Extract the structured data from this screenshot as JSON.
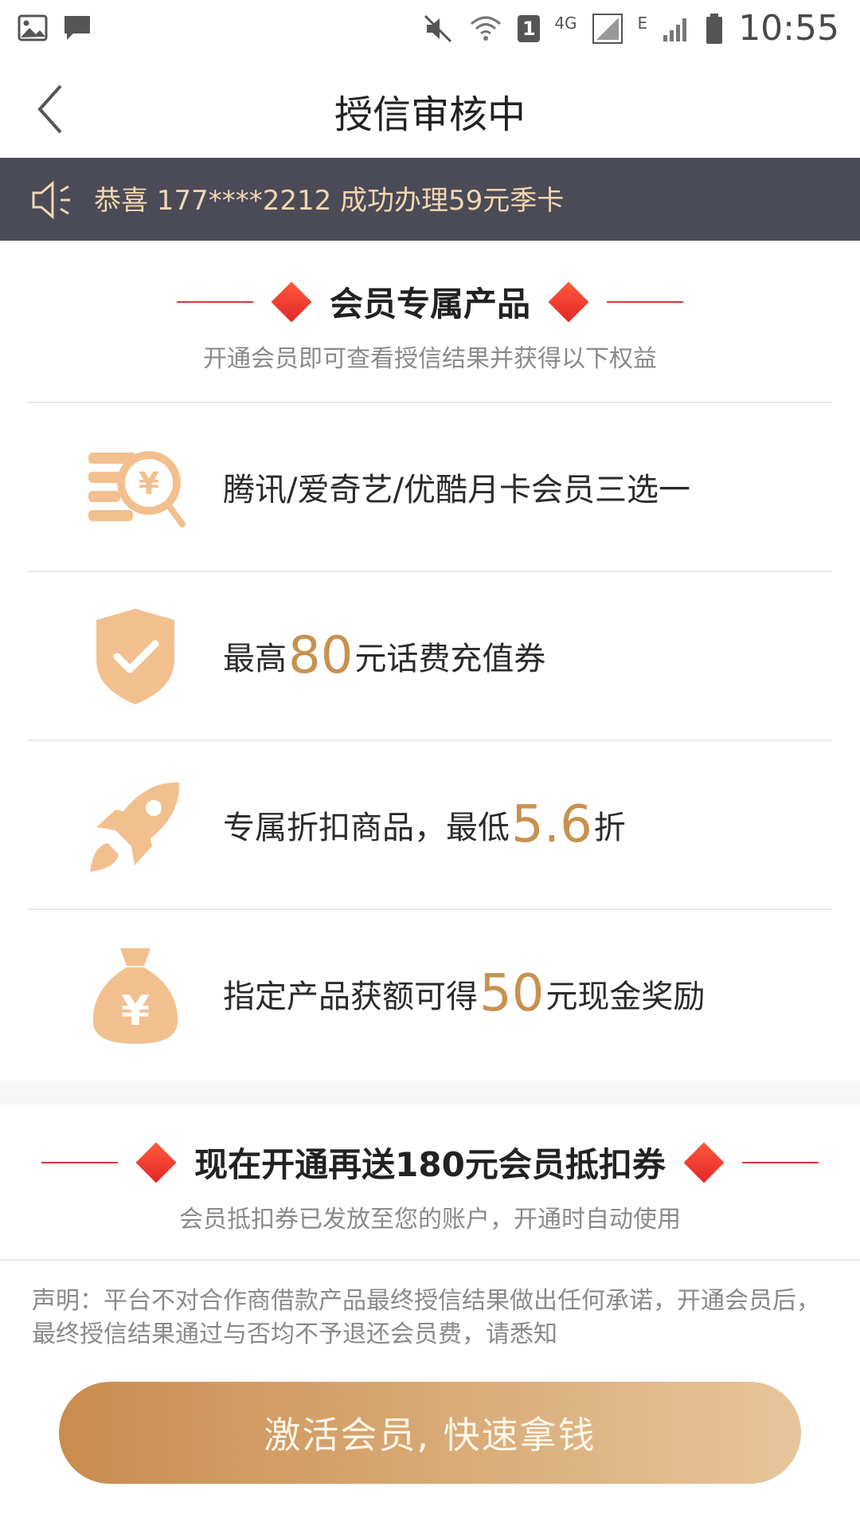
{
  "status_bar": {
    "time": "10:55",
    "icons": [
      "image-icon",
      "chat-icon",
      "mute-icon",
      "wifi-icon",
      "sim1-icon",
      "4g-signal-icon",
      "e-signal-icon",
      "battery-icon"
    ],
    "network_label_1": "4G",
    "network_label_2": "E",
    "sim_label": "1"
  },
  "nav": {
    "title": "授信审核中",
    "back_icon": "chevron-left-icon"
  },
  "notice": {
    "icon": "speaker-icon",
    "text": "恭喜 177****2212 成功办理59元季卡"
  },
  "member_section": {
    "title": "会员专属产品",
    "subtitle": "开通会员即可查看授信结果并获得以下权益",
    "accent_color": "#e3262a"
  },
  "benefits": [
    {
      "icon": "coin-search-icon",
      "text": "腾讯/爱奇艺/优酷月卡会员三选一"
    },
    {
      "icon": "shield-check-icon",
      "prefix": "最高",
      "highlight": "80",
      "suffix": "元话费充值券"
    },
    {
      "icon": "rocket-icon",
      "prefix": "专属折扣商品，最低",
      "highlight": "5.6",
      "suffix": "折"
    },
    {
      "icon": "money-bag-icon",
      "prefix": "指定产品获额可得",
      "highlight": "50",
      "suffix": "元现金奖励"
    }
  ],
  "coupon_section": {
    "title": "现在开通再送180元会员抵扣券",
    "subtitle": "会员抵扣券已发放至您的账户，开通时自动使用"
  },
  "disclaimer": "声明：平台不对合作商借款产品最终授信结果做出任何承诺，开通会员后，最终授信结果通过与否均不予退还会员费，请悉知",
  "cta": {
    "label": "激活会员, 快速拿钱"
  },
  "colors": {
    "highlight": "#c8914f",
    "icon_fill": "#f2c08f",
    "notice_bg": "#4b4a57",
    "notice_text": "#f1d7b0"
  }
}
